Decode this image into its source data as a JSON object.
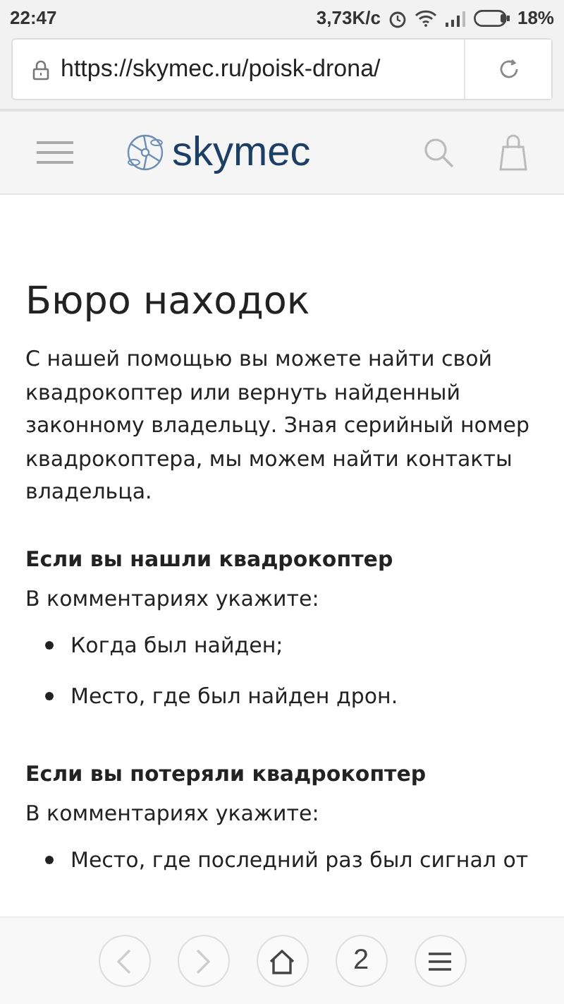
{
  "status_bar": {
    "time": "22:47",
    "speed": "3,73K/c",
    "battery": "18%"
  },
  "address_bar": {
    "url": "https://skymec.ru/poisk-drona/"
  },
  "site_header": {
    "logo_text": "skymec"
  },
  "article": {
    "title": "Бюро находок",
    "intro": "С нашей помощью вы можете найти свой квадрокоптер или вернуть найденный законному владельцу. Зная серийный номер квадрокоптера, мы можем найти контакты владельца.",
    "sections": [
      {
        "heading": "Если вы нашли квадрокоптер",
        "lead": "В комментариях укажите:",
        "items": [
          "Когда был найден;",
          "Место, где был найден дрон."
        ]
      },
      {
        "heading": "Если вы потеряли квадрокоптер",
        "lead": "В комментариях укажите:",
        "items": [
          "Место, где последний раз был сигнал от"
        ]
      }
    ]
  },
  "bottom_nav": [
    {
      "kind": "back",
      "disabled": true
    },
    {
      "kind": "forward",
      "disabled": true
    },
    {
      "kind": "home",
      "disabled": false
    },
    {
      "kind": "tabs",
      "label": "2",
      "disabled": false
    },
    {
      "kind": "menu",
      "disabled": false
    }
  ]
}
